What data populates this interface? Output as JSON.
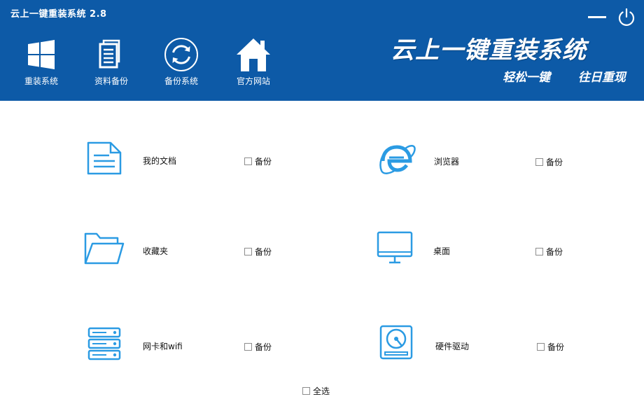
{
  "window": {
    "title": "云上一键重装系统 2.8"
  },
  "toolbar": {
    "items": [
      {
        "label": "重装系统",
        "icon": "windows-icon"
      },
      {
        "label": "资料备份",
        "icon": "documents-icon"
      },
      {
        "label": "备份系统",
        "icon": "refresh-icon"
      },
      {
        "label": "官方网站",
        "icon": "home-icon"
      }
    ]
  },
  "brand": {
    "title": "云上一键重装系统",
    "slogan": "轻松一键  往日重现"
  },
  "backup_items": [
    {
      "label": "我的文档",
      "icon": "document-icon",
      "check_label": "备份",
      "checked": false
    },
    {
      "label": "浏览器",
      "icon": "ie-browser-icon",
      "check_label": "备份",
      "checked": false
    },
    {
      "label": "收藏夹",
      "icon": "folder-icon",
      "check_label": "备份",
      "checked": false
    },
    {
      "label": "桌面",
      "icon": "monitor-icon",
      "check_label": "备份",
      "checked": false
    },
    {
      "label": "网卡和wifi",
      "icon": "network-server-icon",
      "check_label": "备份",
      "checked": false
    },
    {
      "label": "硬件驱动",
      "icon": "hard-drive-icon",
      "check_label": "备份",
      "checked": false
    }
  ],
  "select_all": {
    "label": "全选",
    "checked": false
  },
  "colors": {
    "header_bg": "#0d5aa7",
    "icon_blue": "#2b9be3",
    "text_white": "#ffffff"
  }
}
